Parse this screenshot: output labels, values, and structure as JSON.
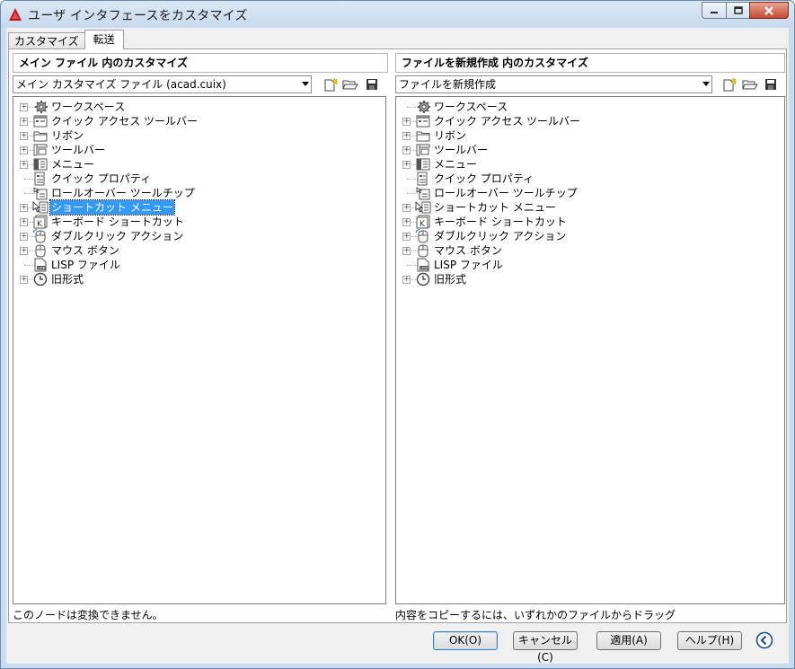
{
  "window": {
    "title": "ユーザ インタフェースをカスタマイズ"
  },
  "tabs": [
    {
      "label": "カスタマイズ",
      "active": false
    },
    {
      "label": "転送",
      "active": true
    }
  ],
  "left_pane": {
    "header": "メイン ファイル 内のカスタマイズ",
    "combo_value": "メイン カスタマイズ ファイル (acad.cuix)",
    "status": "このノードは変換できません。",
    "items": [
      {
        "label": "ワークスペース",
        "icon": "workspace-gear-icon",
        "expandable": true
      },
      {
        "label": "クイック アクセス ツールバー",
        "icon": "quick-access-toolbar-icon",
        "expandable": true
      },
      {
        "label": "リボン",
        "icon": "ribbon-folder-icon",
        "expandable": true
      },
      {
        "label": "ツールバー",
        "icon": "toolbar-icon",
        "expandable": true
      },
      {
        "label": "メニュー",
        "icon": "menu-icon",
        "expandable": true
      },
      {
        "label": "クイック プロパティ",
        "icon": "quick-properties-icon",
        "expandable": false
      },
      {
        "label": "ロールオーバー ツールチップ",
        "icon": "rollover-tooltip-icon",
        "expandable": false
      },
      {
        "label": "ショートカット メニュー",
        "icon": "shortcut-menu-icon",
        "expandable": true,
        "selected": true
      },
      {
        "label": "キーボード ショートカット",
        "icon": "keyboard-shortcut-icon",
        "expandable": true
      },
      {
        "label": "ダブルクリック アクション",
        "icon": "double-click-mouse-icon",
        "expandable": true
      },
      {
        "label": "マウス ボタン",
        "icon": "mouse-button-icon",
        "expandable": true
      },
      {
        "label": "LISP ファイル",
        "icon": "lisp-file-icon",
        "expandable": false
      },
      {
        "label": "旧形式",
        "icon": "legacy-clock-icon",
        "expandable": true
      }
    ]
  },
  "right_pane": {
    "header": "ファイルを新規作成 内のカスタマイズ",
    "combo_value": "ファイルを新規作成",
    "status": "内容をコピーするには、いずれかのファイルからドラッグ",
    "items": [
      {
        "label": "ワークスペース",
        "icon": "workspace-gear-icon",
        "expandable": false
      },
      {
        "label": "クイック アクセス ツールバー",
        "icon": "quick-access-toolbar-icon",
        "expandable": true
      },
      {
        "label": "リボン",
        "icon": "ribbon-folder-icon",
        "expandable": true
      },
      {
        "label": "ツールバー",
        "icon": "toolbar-icon",
        "expandable": true
      },
      {
        "label": "メニュー",
        "icon": "menu-icon",
        "expandable": true
      },
      {
        "label": "クイック プロパティ",
        "icon": "quick-properties-icon",
        "expandable": false
      },
      {
        "label": "ロールオーバー ツールチップ",
        "icon": "rollover-tooltip-icon",
        "expandable": false
      },
      {
        "label": "ショートカット メニュー",
        "icon": "shortcut-menu-icon",
        "expandable": true
      },
      {
        "label": "キーボード ショートカット",
        "icon": "keyboard-shortcut-icon",
        "expandable": true
      },
      {
        "label": "ダブルクリック アクション",
        "icon": "double-click-mouse-icon",
        "expandable": true
      },
      {
        "label": "マウス ボタン",
        "icon": "mouse-button-icon",
        "expandable": true
      },
      {
        "label": "LISP ファイル",
        "icon": "lisp-file-icon",
        "expandable": false
      },
      {
        "label": "旧形式",
        "icon": "legacy-clock-icon",
        "expandable": true
      }
    ]
  },
  "buttons": {
    "ok": "OK(O)",
    "cancel": "キャンセル(C)",
    "apply": "適用(A)",
    "help": "ヘルプ(H)"
  },
  "colors": {
    "selection": "#3399ff",
    "title_bar": "#c9dbef",
    "close_button": "#c44a30",
    "app_icon": "#c8151b"
  }
}
